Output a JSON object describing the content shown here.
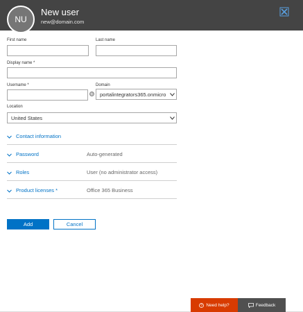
{
  "header": {
    "avatar_initials": "NU",
    "title": "New user",
    "subtitle": "new@domain.com",
    "close_icon": "close-icon",
    "background_color": "#444444"
  },
  "form": {
    "first_name": {
      "label": "First name",
      "value": ""
    },
    "last_name": {
      "label": "Last name",
      "value": ""
    },
    "display_name": {
      "label": "Display name *",
      "value": ""
    },
    "username": {
      "label": "Username *",
      "value": ""
    },
    "at_symbol": "@",
    "domain": {
      "label": "Domain",
      "value": "portalintegrators365.onmicro"
    },
    "location": {
      "label": "Location",
      "value": "United States"
    }
  },
  "sections": [
    {
      "label": "Contact information",
      "value": ""
    },
    {
      "label": "Password",
      "value": "Auto-generated"
    },
    {
      "label": "Roles",
      "value": "User (no administrator access)"
    },
    {
      "label": "Product licenses *",
      "value": "Office 365 Business"
    }
  ],
  "actions": {
    "add_label": "Add",
    "cancel_label": "Cancel",
    "accent_color": "#0072c6"
  },
  "footer": {
    "help_label": "Need help?",
    "help_icon": "help-circle-icon",
    "help_color": "#d83b01",
    "feedback_label": "Feedback",
    "feedback_icon": "chat-bubble-icon"
  }
}
